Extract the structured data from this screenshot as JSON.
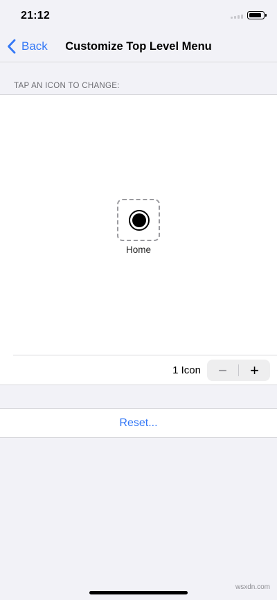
{
  "status_bar": {
    "time": "21:12",
    "signal_icon": "cellular-signal-icon",
    "battery_icon": "battery-icon"
  },
  "nav": {
    "back_label": "Back",
    "back_icon": "chevron-left-icon",
    "title": "Customize Top Level Menu"
  },
  "section": {
    "header": "TAP AN ICON TO CHANGE:"
  },
  "icons": [
    {
      "label": "Home",
      "icon": "home-circle-icon"
    }
  ],
  "count": {
    "label": "1 Icon",
    "minus": "−",
    "plus": "+"
  },
  "reset": {
    "label": "Reset..."
  },
  "watermark": "wsxdn.com",
  "colors": {
    "accent": "#3478f6",
    "background": "#f2f2f7"
  }
}
